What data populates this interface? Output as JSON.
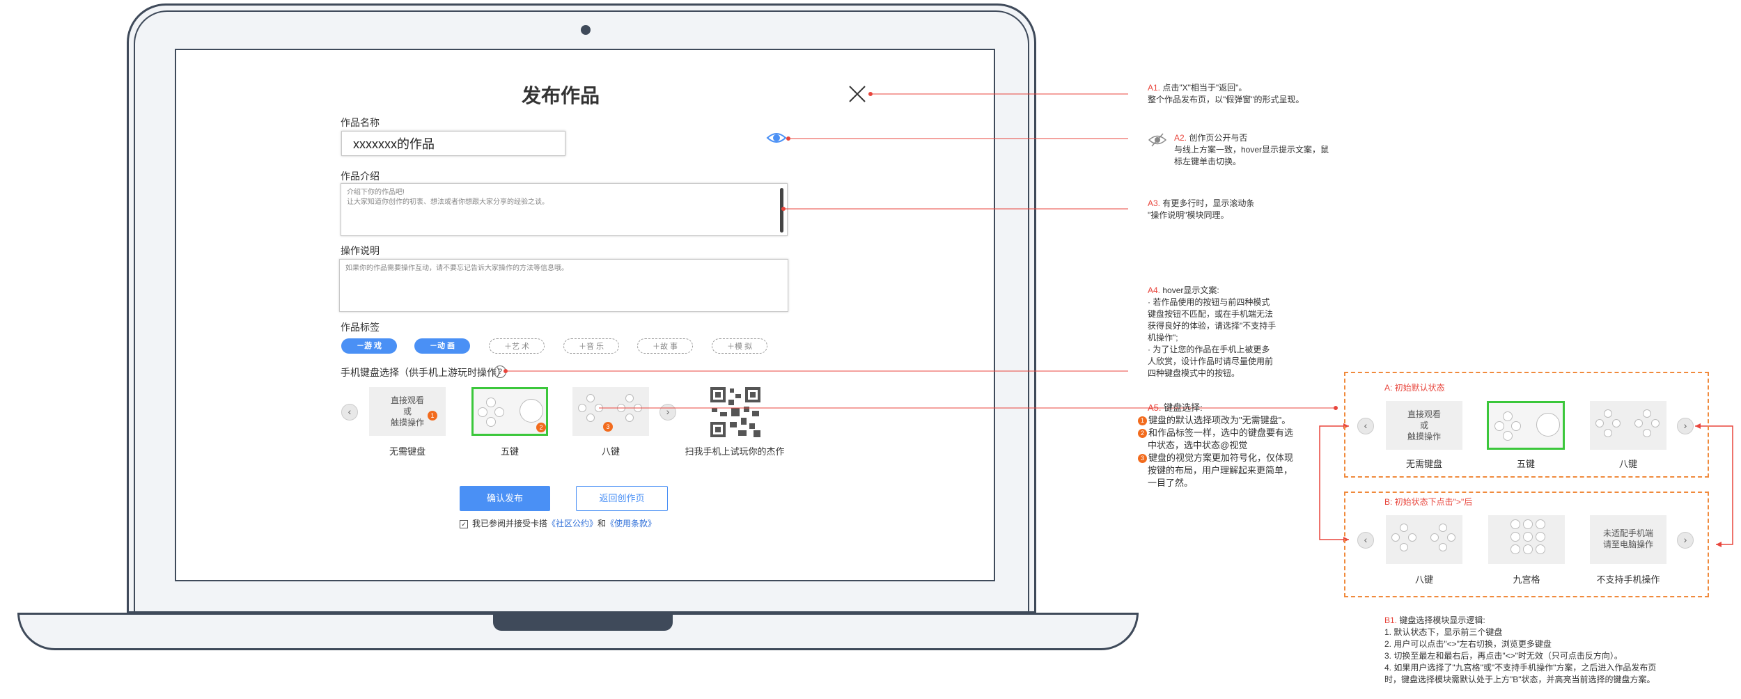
{
  "form": {
    "title": "发布作品",
    "name_label": "作品名称",
    "name_value": "xxxxxxx的作品",
    "intro_label": "作品介绍",
    "intro_line1": "介绍下你的作品吧!",
    "intro_line2": "让大家知道你创作的初衷、想法或者你想跟大家分享的经验之谈。",
    "ops_label": "操作说明",
    "ops_placeholder": "如果你的作品需要操作互动，请不要忘记告诉大家操作的方法等信息哦。",
    "tags_label": "作品标签",
    "tags": [
      {
        "label": "－游 戏",
        "selected": true
      },
      {
        "label": "－动 画",
        "selected": true
      },
      {
        "label": "＋艺 术",
        "selected": false
      },
      {
        "label": "＋音 乐",
        "selected": false
      },
      {
        "label": "＋故 事",
        "selected": false
      },
      {
        "label": "＋模 拟",
        "selected": false
      }
    ],
    "keyboard_label": "手机键盘选择（供手机上游玩时操作）",
    "help_icon": "?",
    "keyboards": [
      {
        "card_text": [
          "直接观看",
          "或",
          "触摸操作"
        ],
        "name": "无需键盘",
        "badge": "1"
      },
      {
        "name": "五键",
        "badge": "2",
        "selected": true
      },
      {
        "name": "八键",
        "badge": "3"
      }
    ],
    "qr_caption": "扫我手机上试玩你的杰作",
    "confirm_label": "确认发布",
    "back_label": "返回创作页",
    "agree_prefix": "我已参阅并接受卡搭",
    "agree_link1": "《社区公约》",
    "agree_and": "和",
    "agree_link2": "《使用条款》",
    "prev_arrow": "‹",
    "next_arrow": "›",
    "checkbox_mark": "✓"
  },
  "annotations": {
    "a1": {
      "tag": "A1.",
      "line1": "点击\"X\"相当于\"返回\"。",
      "line2": "整个作品发布页，以\"假弹窗\"的形式呈现。"
    },
    "a2": {
      "tag": "A2.",
      "line1": "创作页公开与否",
      "line2": "与线上方案一致，hover显示提示文案，鼠",
      "line3": "标左键单击切换。"
    },
    "a3": {
      "tag": "A3.",
      "line1": "有更多行时，显示滚动条",
      "line2": "\"操作说明\"模块同理。"
    },
    "a4": {
      "tag": "A4.",
      "head": "hover显示文案:",
      "lines": [
        "· 若作品使用的按钮与前四种模式",
        "键盘按钮不匹配，或在手机端无法",
        "获得良好的体验，请选择\"不支持手",
        "机操作\";",
        "· 为了让您的作品在手机上被更多",
        "人欣赏，设计作品时请尽量使用前",
        "四种键盘模式中的按钮。"
      ]
    },
    "a5": {
      "tag": "A5.",
      "head": "键盘选择:",
      "items": [
        {
          "num": "1",
          "lines": [
            "键盘的默认选择项改为\"无需键盘\"。"
          ]
        },
        {
          "num": "2",
          "lines": [
            "和作品标签一样，选中的键盘要有选",
            "中状态，选中状态@视觉"
          ]
        },
        {
          "num": "3",
          "lines": [
            "键盘的视觉方案更加符号化，仅体现",
            "按键的布局，用户理解起来更简单，",
            "一目了然。"
          ]
        }
      ]
    },
    "b1": {
      "tag": "B1.",
      "head": "键盘选择模块显示逻辑:",
      "lines": [
        "1. 默认状态下，显示前三个键盘",
        "2. 用户可以点击\"<>\"左右切换，浏览更多键盘",
        "3. 切换至最左和最右后，再点击\"<>\"时无效（只可点击反方向）。",
        "4. 如果用户选择了\"九宫格\"或\"不支持手机操作\"方案，之后进入作品发布页",
        "时，键盘选择模块需默认处于上方\"B\"状态，并高亮当前选择的键盘方案。"
      ]
    }
  },
  "panel_a": {
    "title": "A:  初始默认状态",
    "cards": [
      {
        "text": [
          "直接观看",
          "或",
          "触摸操作"
        ],
        "name": "无需键盘"
      },
      {
        "name": "五键",
        "selected": true
      },
      {
        "name": "八键"
      }
    ]
  },
  "panel_b": {
    "title": "B:  初始状态下点击\">\"后",
    "cards": [
      {
        "name": "八键"
      },
      {
        "name": "九宫格"
      },
      {
        "text": [
          "未适配手机端",
          "请至电脑操作"
        ],
        "name": "不支持手机操作"
      }
    ]
  },
  "colors": {
    "primary": "#4a90f5",
    "selected_border": "#3bc73b",
    "annotation_red": "#e8453c",
    "panel_orange": "#f08a3c",
    "badge_orange": "#f26b1d",
    "frame": "#3f4a5a"
  }
}
